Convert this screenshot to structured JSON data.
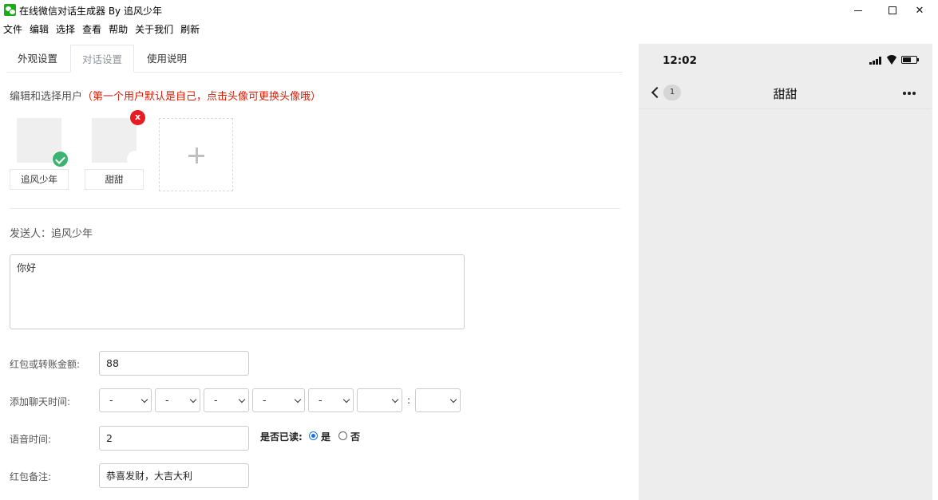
{
  "window": {
    "title": "在线微信对话生成器 By 追风少年"
  },
  "menu": [
    "文件",
    "编辑",
    "选择",
    "查看",
    "帮助",
    "关于我们",
    "刷新"
  ],
  "tabs": [
    "外观设置",
    "对话设置",
    "使用说明"
  ],
  "active_tab": "对话设置",
  "users_section": {
    "label": "编辑和选择用户",
    "hint": "（第一个用户默认是自己，点击头像可更换头像哦）"
  },
  "users": [
    {
      "name": "追风少年",
      "selected": true
    },
    {
      "name": "甜甜",
      "selected": false,
      "delete_label": "x"
    }
  ],
  "sender": {
    "label": "发送人：",
    "name": "追风少年"
  },
  "message": {
    "value": "你好"
  },
  "form": {
    "amount_label": "红包或转账金额:",
    "amount_value": "88",
    "time_label": "添加聊天时间:",
    "time_selects": [
      "-",
      "-",
      "-",
      "-",
      "-",
      "",
      ""
    ],
    "time_colon": ":",
    "voice_label": "语音时间:",
    "voice_value": "2",
    "read_label": "是否已读:",
    "read_yes": "是",
    "read_no": "否",
    "read_selected": "是",
    "remark_label": "红包备注:",
    "remark_value": "恭喜发财，大吉大利"
  },
  "phone": {
    "time": "12:02",
    "unread_count": "1",
    "chat_title": "甜甜",
    "background": "#ededed"
  },
  "colors": {
    "accent_green": "#3cb371",
    "delete_red": "#e51c23",
    "hint_red": "#d81e06",
    "radio_blue": "#1a73e8"
  }
}
